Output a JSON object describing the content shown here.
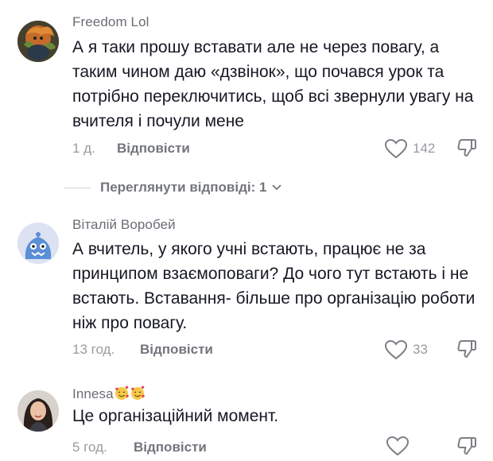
{
  "comments": [
    {
      "author": "Freedom Lol",
      "text": "А я таки прошу вставати але не через повагу, а таким чином даю «дзвінок», що почався урок та потрібно переключитись, щоб всі звернули увагу на вчителя і почули мене",
      "time": "1 д.",
      "reply_label": "Відповісти",
      "likes": "142"
    },
    {
      "author": "Віталій Воробей",
      "text": "А вчитель, у якого учні встають, працює не за принципом взаємоповаги? До чого тут встають і не встають. Вставання- більше про організацію роботи ніж про повагу.",
      "time": "13 год.",
      "reply_label": "Відповісти",
      "likes": "33"
    },
    {
      "author": "Innesa",
      "author_emojis": [
        "smiling-face-with-hearts",
        "smiling-face-with-hearts"
      ],
      "text": "Це організаційний момент.",
      "time": "5 год.",
      "reply_label": "Відповісти",
      "likes": ""
    }
  ],
  "view_replies": {
    "label": "Переглянути відповіді: 1"
  },
  "icons": {
    "like": "heart-outline-icon",
    "dislike": "thumbs-down-outline-icon",
    "expand": "chevron-down-icon"
  }
}
